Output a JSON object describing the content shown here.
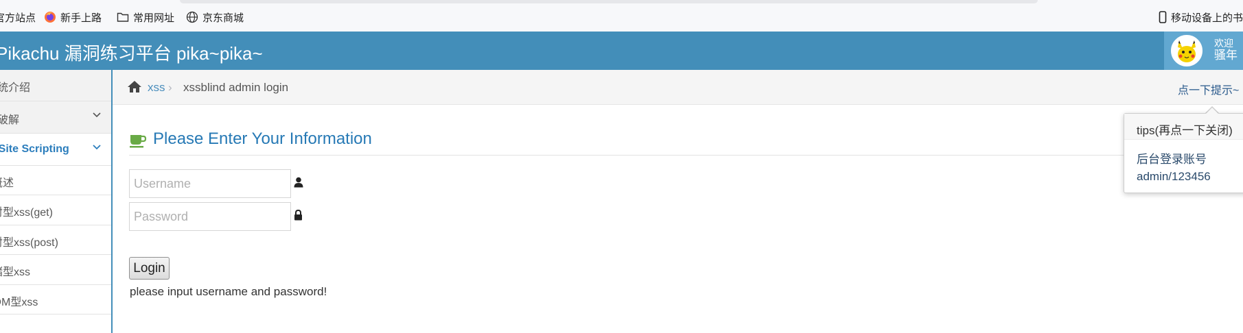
{
  "bookmarks": [
    {
      "label": "官方站点",
      "icon": "site-icon"
    },
    {
      "label": "新手上路",
      "icon": "firefox-icon"
    },
    {
      "label": "常用网址",
      "icon": "folder-icon"
    },
    {
      "label": "京东商城",
      "icon": "globe-icon"
    }
  ],
  "mobile_bookmark": {
    "label": "移动设备上的书签",
    "icon": "mobile-icon"
  },
  "app": {
    "title": "Pikachu 漏洞练习平台 pika~pika~"
  },
  "user": {
    "welcome": "欢迎",
    "name": "骚年",
    "avatar_icon": "pikachu-avatar-icon"
  },
  "sidebar": {
    "items": [
      {
        "label": "系统介绍"
      },
      {
        "label": "暴力破解"
      },
      {
        "label": "Cross-Site Scripting"
      },
      {
        "label": "概述"
      },
      {
        "label": "反射型xss(get)"
      },
      {
        "label": "反射型xss(post)"
      },
      {
        "label": "存储型xss"
      },
      {
        "label": "DOM型xss"
      }
    ]
  },
  "breadcrumb": {
    "home_icon": "home-icon",
    "link": "xss",
    "separator": "›",
    "current": "xssblind admin login"
  },
  "tip_link": "点一下提示~",
  "page": {
    "title": "Please Enter Your Information",
    "title_icon": "coffee-cup-icon"
  },
  "form": {
    "username_placeholder": "Username",
    "username_value": "",
    "password_placeholder": "Password",
    "password_value": "",
    "login_label": "Login",
    "message": "please input username and password!"
  },
  "popover": {
    "title": "tips(再点一下关闭)",
    "line1": "后台登录账号",
    "line2": "admin/123456"
  },
  "colors": {
    "accent": "#438eb9",
    "link": "#2679b5",
    "sidebar_active": "#2b7dbc"
  }
}
